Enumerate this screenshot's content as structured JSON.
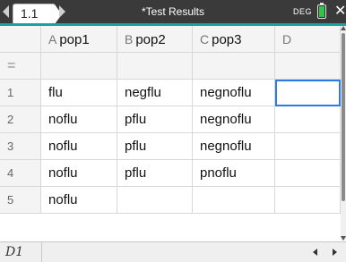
{
  "tab": {
    "label": "1.1"
  },
  "document": {
    "title": "*Test Results"
  },
  "status": {
    "angle_mode": "DEG",
    "battery_color": "#35c24a",
    "accent_color": "#1d9fa6"
  },
  "columns": [
    {
      "letter": "A",
      "name": "pop1"
    },
    {
      "letter": "B",
      "name": "pop2"
    },
    {
      "letter": "C",
      "name": "pop3"
    },
    {
      "letter": "D",
      "name": ""
    }
  ],
  "formula_row_symbol": "=",
  "rows": [
    {
      "num": "1",
      "cells": [
        "flu",
        "negflu",
        "negnoflu",
        ""
      ]
    },
    {
      "num": "2",
      "cells": [
        "noflu",
        "pflu",
        "negnoflu",
        ""
      ]
    },
    {
      "num": "3",
      "cells": [
        "noflu",
        "pflu",
        "negnoflu",
        ""
      ]
    },
    {
      "num": "4",
      "cells": [
        "noflu",
        "pflu",
        "pnoflu",
        ""
      ]
    },
    {
      "num": "5",
      "cells": [
        "noflu",
        "",
        "",
        ""
      ]
    }
  ],
  "selected_cell": "D1",
  "icons": {
    "close": "close-icon",
    "battery": "battery-icon"
  }
}
